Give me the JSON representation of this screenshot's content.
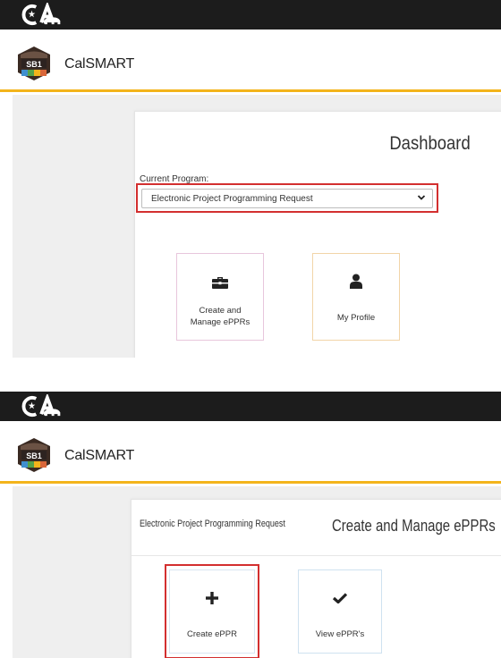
{
  "app": {
    "name": "CalSMART",
    "brand_accent": "#f3b41b",
    "highlight_color": "#d32f2f"
  },
  "screen1": {
    "title": "Dashboard",
    "program_label": "Current Program:",
    "program_selected": "Electronic Project Programming Request",
    "tiles": [
      {
        "label_line1": "Create and",
        "label_line2": "Manage ePPRs",
        "icon": "briefcase-icon"
      },
      {
        "label_line1": "My Profile",
        "icon": "user-icon"
      }
    ]
  },
  "screen2": {
    "program_name": "Electronic Project Programming Request",
    "title": "Create and Manage ePPRs",
    "tiles": [
      {
        "label": "Create ePPR",
        "icon": "plus-icon"
      },
      {
        "label": "View ePPR's",
        "icon": "checkmark-icon"
      }
    ]
  }
}
